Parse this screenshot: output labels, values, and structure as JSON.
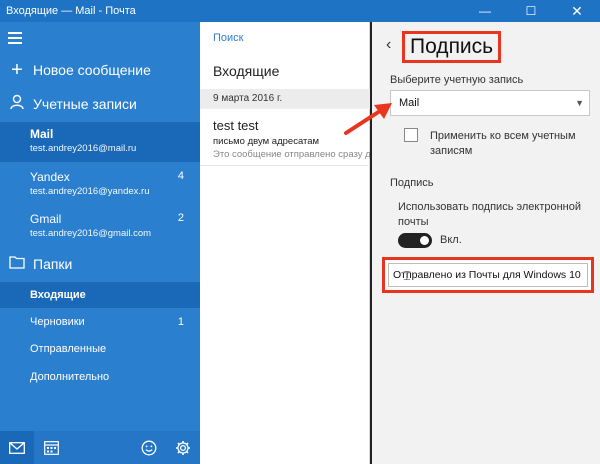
{
  "window": {
    "title": "Входящие — Mail - Почта",
    "minimize": "—",
    "maximize": "☐",
    "close": "✕"
  },
  "sidebar": {
    "new_message": "Новое сообщение",
    "accounts_label": "Учетные записи",
    "accounts": [
      {
        "name": "Mail",
        "email": "test.andrey2016@mail.ru",
        "count": ""
      },
      {
        "name": "Yandex",
        "email": "test.andrey2016@yandex.ru",
        "count": "4"
      },
      {
        "name": "Gmail",
        "email": "test.andrey2016@gmail.com",
        "count": "2"
      }
    ],
    "folders_label": "Папки",
    "folders": [
      {
        "label": "Входящие",
        "count": ""
      },
      {
        "label": "Черновики",
        "count": "1"
      },
      {
        "label": "Отправленные",
        "count": ""
      },
      {
        "label": "Дополнительно",
        "count": ""
      }
    ]
  },
  "list": {
    "search": "Поиск",
    "title": "Входящие",
    "date": "9 марта 2016 г.",
    "messages": [
      {
        "from": "test test",
        "subject": "письмо двум адресатам",
        "preview": "Это сообщение отправлено сразу дв"
      }
    ]
  },
  "panel": {
    "title": "Подпись",
    "choose_account_label": "Выберите учетную запись",
    "selected_account": "Mail",
    "apply_all_label": "Применить ко всем учетным записям",
    "signature_section": "Подпись",
    "use_signature_label": "Использовать подпись электронной почты",
    "toggle_state": "Вкл.",
    "signature_text": "Отправлено из Почты для Windows 10"
  },
  "colors": {
    "accent": "#2b7fcf",
    "annotation": "#e8351f"
  }
}
